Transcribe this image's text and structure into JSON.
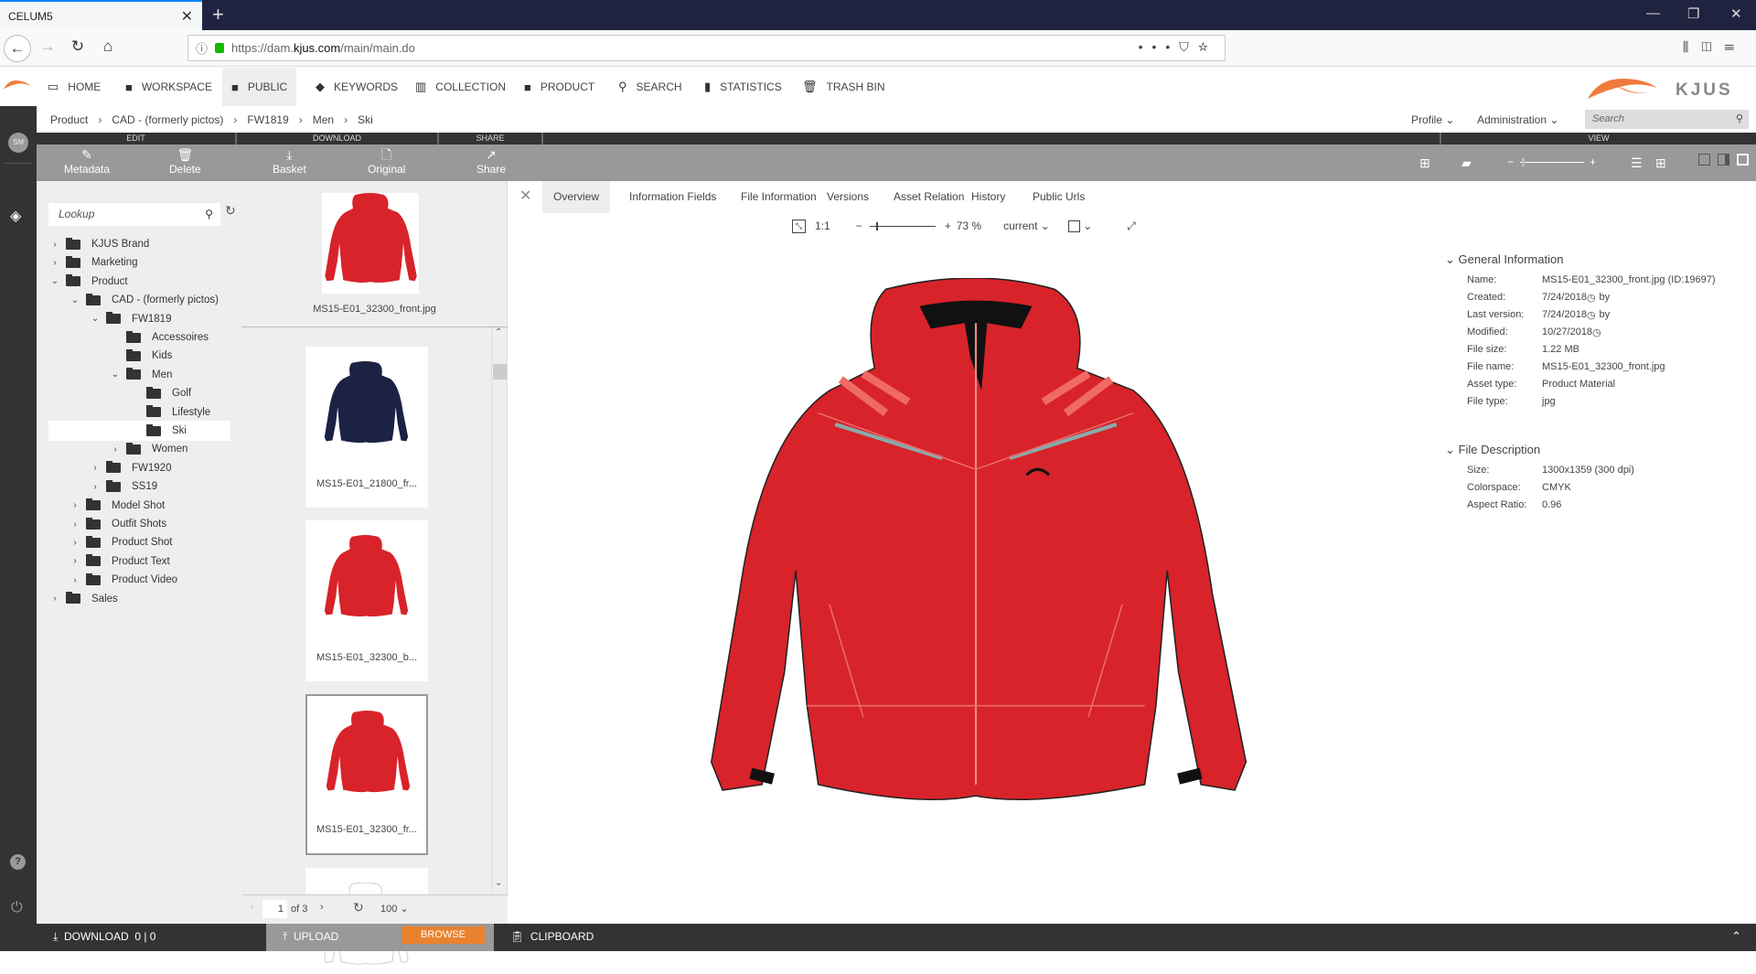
{
  "browser": {
    "tab_title": "CELUM5",
    "url_scheme": "https://dam.",
    "url_host": "kjus.com",
    "url_path": "/main/main.do"
  },
  "mainnav": {
    "items": [
      {
        "label": "HOME",
        "icon": "monitor-icon"
      },
      {
        "label": "WORKSPACE",
        "icon": "folder-icon"
      },
      {
        "label": "PUBLIC",
        "icon": "folder-icon",
        "active": true
      },
      {
        "label": "KEYWORDS",
        "icon": "tag-icon"
      },
      {
        "label": "COLLECTION",
        "icon": "collection-icon"
      },
      {
        "label": "PRODUCT",
        "icon": "folder-icon"
      },
      {
        "label": "SEARCH",
        "icon": "search-icon"
      },
      {
        "label": "STATISTICS",
        "icon": "bar-chart-icon"
      },
      {
        "label": "TRASH BIN",
        "icon": "trash-icon"
      }
    ],
    "brand": "KJUS",
    "brand_color": "#f07a3c"
  },
  "user": {
    "initials": "SM"
  },
  "breadcrumb": [
    "Product",
    "CAD - (formerly pictos)",
    "FW1819",
    "Men",
    "Ski"
  ],
  "header_right": {
    "profile": "Profile",
    "administration": "Administration",
    "search_placeholder": "Search"
  },
  "toolbar": {
    "groups": {
      "edit": "EDIT",
      "download": "DOWNLOAD",
      "share": "SHARE",
      "view": "VIEW"
    },
    "buttons": {
      "metadata": "Metadata",
      "delete": "Delete",
      "basket": "Basket",
      "original": "Original",
      "share": "Share"
    }
  },
  "tree": {
    "lookup_placeholder": "Lookup",
    "items": [
      {
        "label": "KJUS Brand",
        "level": 0,
        "expander": "collapsed"
      },
      {
        "label": "Marketing",
        "level": 0,
        "expander": "collapsed"
      },
      {
        "label": "Product",
        "level": 0,
        "expander": "expanded"
      },
      {
        "label": "CAD - (formerly pictos)",
        "level": 1,
        "expander": "expanded"
      },
      {
        "label": "FW1819",
        "level": 2,
        "expander": "expanded"
      },
      {
        "label": "Accessoires",
        "level": 3,
        "expander": "none"
      },
      {
        "label": "Kids",
        "level": 3,
        "expander": "none"
      },
      {
        "label": "Men",
        "level": 3,
        "expander": "expanded"
      },
      {
        "label": "Golf",
        "level": 4,
        "expander": "none"
      },
      {
        "label": "Lifestyle",
        "level": 4,
        "expander": "none"
      },
      {
        "label": "Ski",
        "level": 4,
        "expander": "none",
        "selected": true
      },
      {
        "label": "Women",
        "level": 3,
        "expander": "collapsed"
      },
      {
        "label": "FW1920",
        "level": 2,
        "expander": "collapsed"
      },
      {
        "label": "SS19",
        "level": 2,
        "expander": "collapsed"
      },
      {
        "label": "Model Shot",
        "level": 1,
        "expander": "collapsed"
      },
      {
        "label": "Outfit Shots",
        "level": 1,
        "expander": "collapsed"
      },
      {
        "label": "Product Shot",
        "level": 1,
        "expander": "collapsed"
      },
      {
        "label": "Product Text",
        "level": 1,
        "expander": "collapsed"
      },
      {
        "label": "Product Video",
        "level": 1,
        "expander": "collapsed"
      },
      {
        "label": "Sales",
        "level": 0,
        "expander": "collapsed"
      }
    ]
  },
  "assets": {
    "pinned": {
      "name": "MS15-E01_32300_front.jpg",
      "color": "#d8232a"
    },
    "items": [
      {
        "name": "MS15-E01_21800_fr...",
        "color": "#1b2244"
      },
      {
        "name": "MS15-E01_32300_b...",
        "color": "#d8232a"
      },
      {
        "name": "MS15-E01_32300_fr...",
        "color": "#d8232a",
        "selected": true
      },
      {
        "name": "",
        "color": "#ffffff"
      }
    ],
    "pager": {
      "page": "1",
      "of": "of 3",
      "page_size": "100"
    }
  },
  "detail": {
    "tabs": [
      "Overview",
      "Information Fields",
      "File Information",
      "Versions",
      "Asset Relation",
      "History",
      "Public Urls"
    ],
    "active_tab": "Overview",
    "viewer": {
      "ratio": "1:1",
      "zoom": "73 %",
      "zoom_fraction": 0.1,
      "version": "current"
    },
    "general_title": "General Information",
    "general": [
      {
        "k": "Name:",
        "v": "MS15-E01_32300_front.jpg (ID:19697)"
      },
      {
        "k": "Created:",
        "v": "7/24/2018",
        "clock": true,
        "by": "by"
      },
      {
        "k": "Last version:",
        "v": "7/24/2018",
        "clock": true,
        "by": "by"
      },
      {
        "k": "Modified:",
        "v": "10/27/2018",
        "clock": true,
        "by": ""
      },
      {
        "k": "File size:",
        "v": "1.22 MB"
      },
      {
        "k": "File name:",
        "v": "MS15-E01_32300_front.jpg"
      },
      {
        "k": "Asset type:",
        "v": "Product Material"
      },
      {
        "k": "File type:",
        "v": "jpg"
      }
    ],
    "desc_title": "File Description",
    "description": [
      {
        "k": "Size:",
        "v": "1300x1359 (300 dpi)"
      },
      {
        "k": "Colorspace:",
        "v": "CMYK"
      },
      {
        "k": "Aspect Ratio:",
        "v": "0.96"
      }
    ]
  },
  "bottombar": {
    "download": "DOWNLOAD",
    "download_count": "0 | 0",
    "upload": "UPLOAD",
    "browse": "BROWSE",
    "clipboard": "CLIPBOARD"
  }
}
